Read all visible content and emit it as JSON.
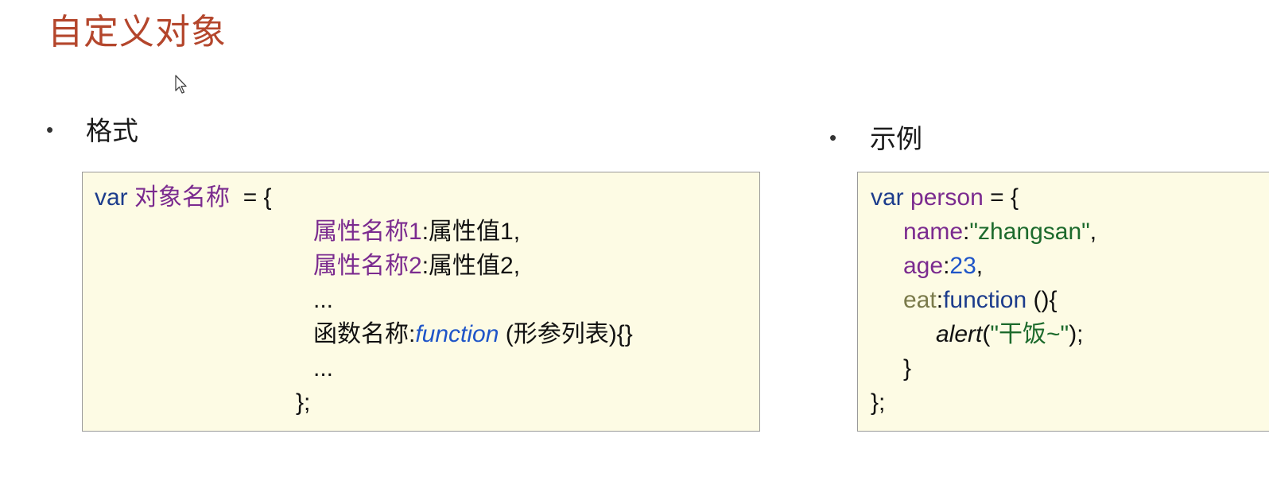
{
  "title": "自定义对象",
  "format": {
    "label": "格式",
    "bullet": "•",
    "code": {
      "var_kw": "var",
      "obj_name": "对象名称",
      "assign_open": "  = {",
      "prop1_name": "属性名称1",
      "prop1_rest": ":属性值1,",
      "prop2_name": "属性名称2",
      "prop2_rest": ":属性值2,",
      "ellipsis1": "...",
      "func_name": "函数名称:",
      "func_kw": "function",
      "func_rest": " (形参列表){}",
      "ellipsis2": "...",
      "close": "};"
    }
  },
  "example": {
    "label": "示例",
    "bullet": "•",
    "code": {
      "var_kw": "var",
      "obj_name": "person",
      "assign_open": " = {",
      "name_key": "name",
      "name_colon": ":",
      "name_val": "\"zhangsan\"",
      "name_comma": ",",
      "age_key": "age",
      "age_colon": ":",
      "age_val": "23",
      "age_comma": ",",
      "eat_key": "eat",
      "eat_colon": ":",
      "eat_kw": "function",
      "eat_rest": " (){",
      "alert_fn": "alert",
      "alert_open": "(",
      "alert_str": "\"干饭~\"",
      "alert_close": ");",
      "inner_close": "}",
      "outer_close": "};"
    }
  },
  "colors": {
    "title": "#b4462c",
    "keyword": "#1c3c8c",
    "property": "#7b2b8f",
    "string": "#1c6a2c",
    "number": "#1f55c8",
    "box_bg": "#fdfbe4"
  }
}
